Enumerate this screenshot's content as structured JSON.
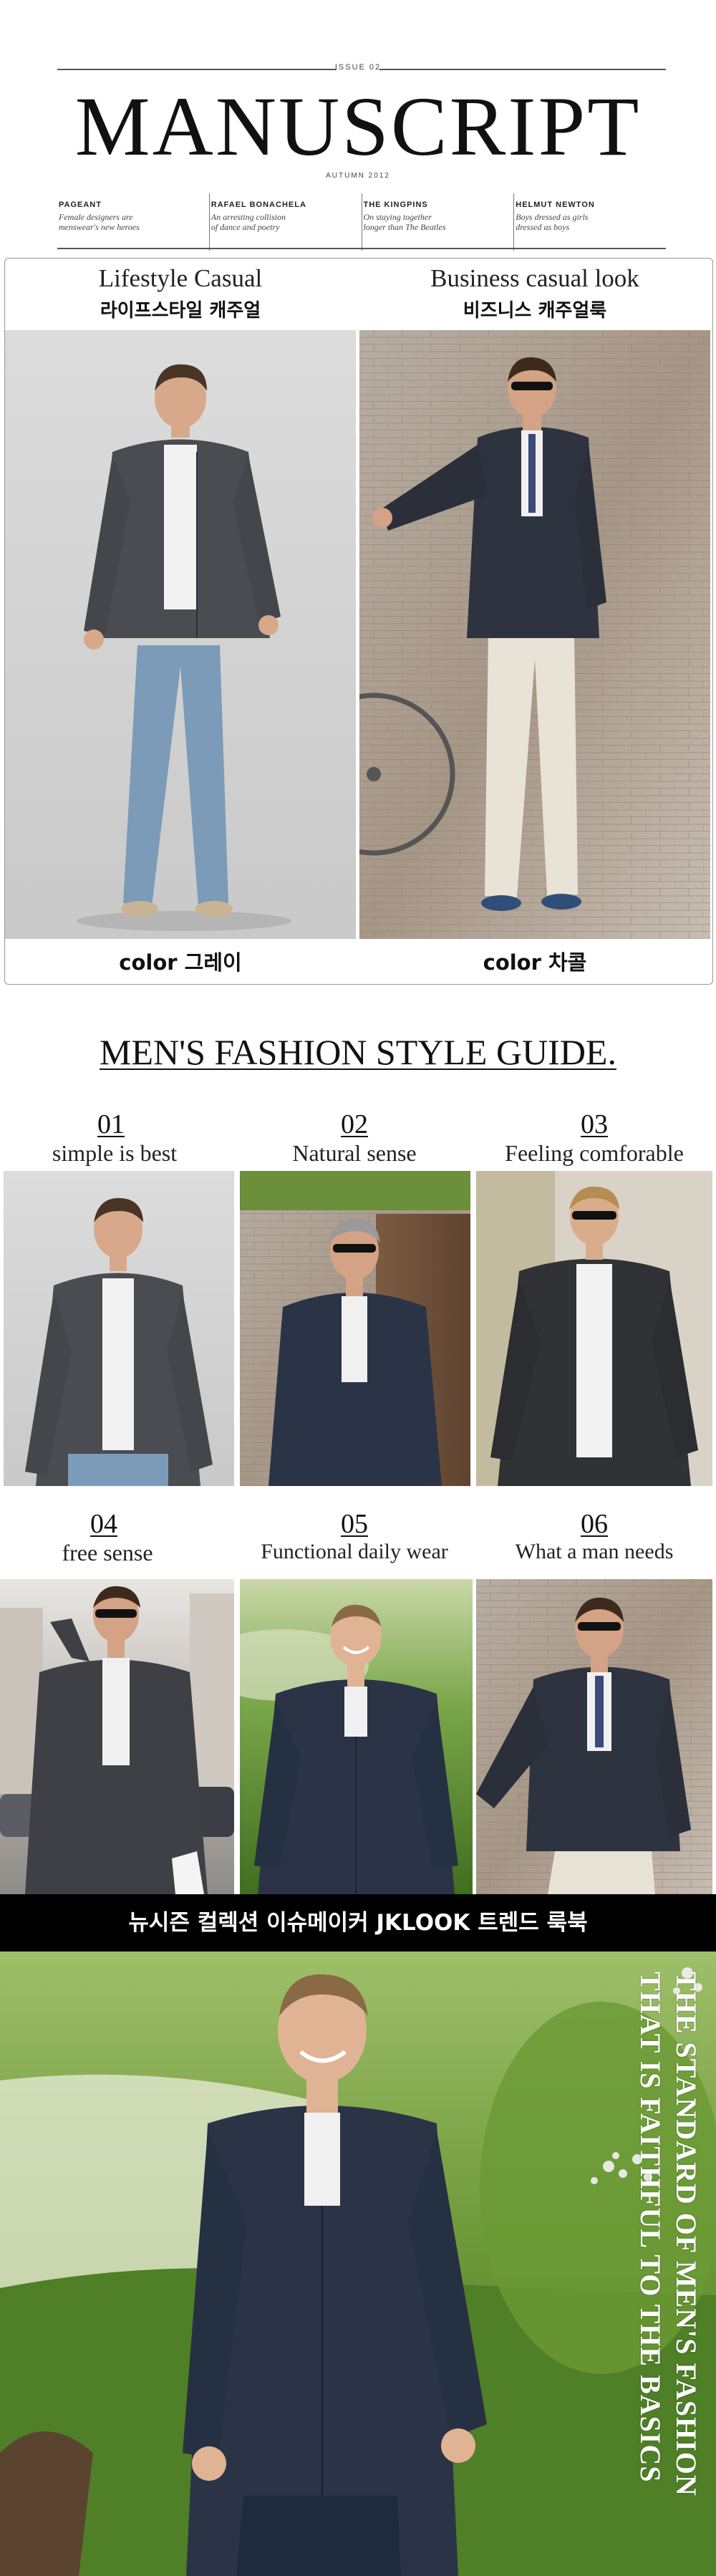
{
  "masthead": {
    "issue": "ISSUE 02",
    "brand": "MANUSCRIPT",
    "season": "AUTUMN 2012",
    "teasers": [
      {
        "head": "PAGEANT",
        "sub": "Female designers are\nmenswear's new heroes"
      },
      {
        "head": "RAFAEL BONACHELA",
        "sub": "An arresting collision\nof dance and poetry"
      },
      {
        "head": "THE KINGPINS",
        "sub": "On staying together\nlonger than The Beatles"
      },
      {
        "head": "HELMUT NEWTON",
        "sub": "Boys dressed as girls\ndressed as boys"
      }
    ]
  },
  "color_panel": {
    "left": {
      "title": "Lifestyle Casual",
      "subtitle": "라이프스타일 캐주얼",
      "caption": "color 그레이"
    },
    "right": {
      "title": "Business casual look",
      "subtitle": "비즈니스 캐주얼룩",
      "caption": "color 차콜"
    }
  },
  "guide": {
    "title": "MEN'S FASHION STYLE GUIDE.",
    "items": [
      {
        "num": "01",
        "label": "simple is best"
      },
      {
        "num": "02",
        "label": "Natural sense"
      },
      {
        "num": "03",
        "label": "Feeling comforable"
      },
      {
        "num": "04",
        "label": "free sense"
      },
      {
        "num": "05",
        "label": "Functional daily wear"
      },
      {
        "num": "06",
        "label": "What a man needs"
      }
    ]
  },
  "banner": {
    "text": "뉴시즌 컬렉션 이슈메이커  JKLOOK 트렌드 룩북"
  },
  "hero": {
    "line1": "THE STANDARD OF MEN'S FASHION",
    "line2": "THAT IS FAITHFUL TO THE BASICS"
  },
  "colors": {
    "jacket_grey": "#4a4c52",
    "jacket_navy": "#2b3447",
    "banner_bg": "#000000",
    "grass": "#5f8a2e"
  }
}
